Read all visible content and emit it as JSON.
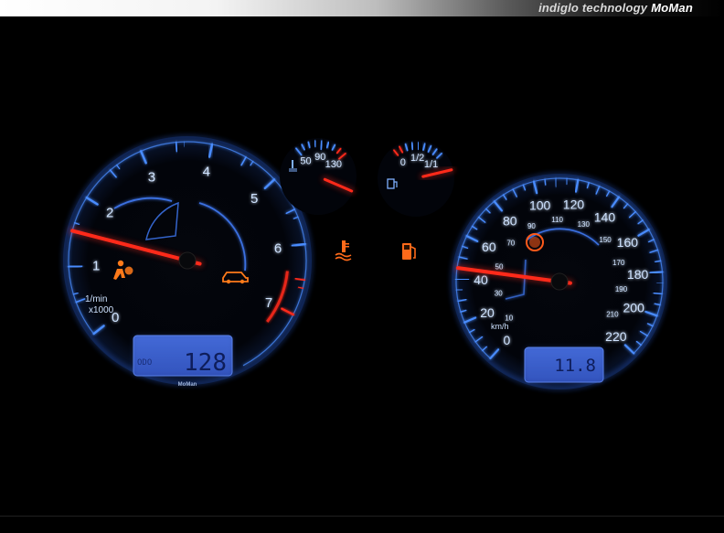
{
  "banner": {
    "text": "indiglo technology",
    "brand": "MoMan"
  },
  "tachometer": {
    "labels": [
      "0",
      "1",
      "2",
      "3",
      "4",
      "5",
      "6",
      "7"
    ],
    "unit_line1": "1/min",
    "unit_line2": "x1000",
    "needle_value": 1.5,
    "lcd_value": "128",
    "lcd_prefix": "ODO",
    "brand_small": "MoMan",
    "airbag_icon": "airbag-icon",
    "car_icon": "car-door-icon"
  },
  "temperature_gauge": {
    "labels": [
      "50",
      "90",
      "130"
    ],
    "needle_value": 115,
    "icon": "coolant-temperature-icon"
  },
  "fuel_gauge": {
    "labels": [
      "0",
      "1/2",
      "1/1"
    ],
    "needle_fraction": 0.65,
    "icon": "fuel-pump-icon"
  },
  "center_warnings": {
    "coolant_icon": "coolant-warning-icon",
    "fuel_icon": "fuel-warning-icon"
  },
  "speedometer": {
    "major_labels": [
      "0",
      "20",
      "40",
      "60",
      "80",
      "100",
      "120",
      "140",
      "160",
      "180",
      "200",
      "220"
    ],
    "minor_labels": [
      "10",
      "30",
      "50",
      "70",
      "90",
      "110",
      "130",
      "150",
      "170",
      "190",
      "210"
    ],
    "unit": "km/h",
    "needle_value": 45,
    "abs_icon": "abs-warning-icon",
    "lcd_value": "11.8"
  },
  "colors": {
    "backlight": "#4a8cff",
    "label": "#cfe3ff",
    "needle": "#ff2a1a",
    "warning": "#ff7a1a"
  }
}
